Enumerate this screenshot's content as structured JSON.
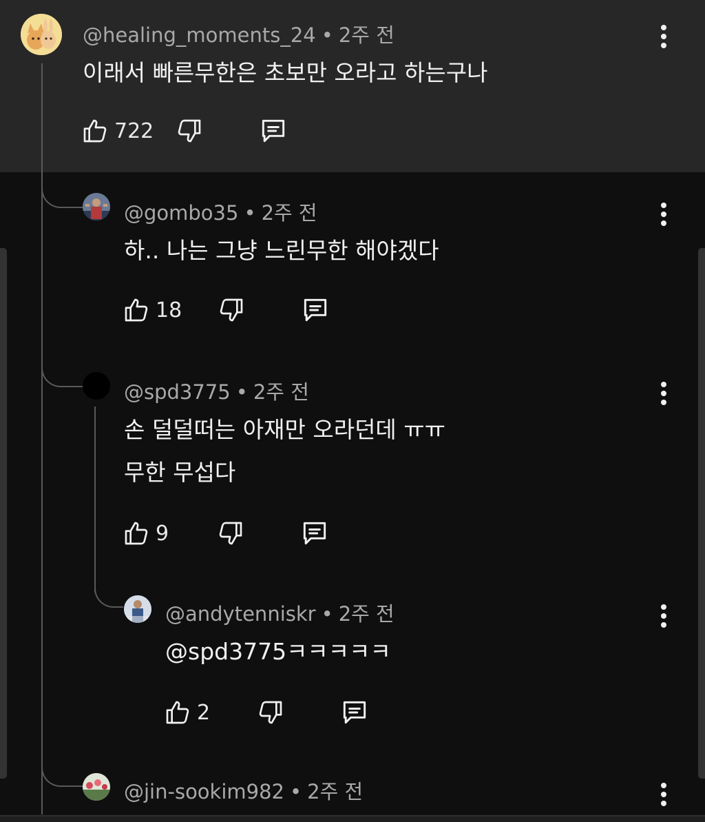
{
  "comments": [
    {
      "handle": "@healing_moments_24",
      "time": "2주 전",
      "lines": [
        "이래서 빠른무한은 초보만 오라고 하는구나"
      ],
      "likes": "722",
      "avatar_icon": "cat-dog-cartoon-avatar",
      "accent": "#f5d58a"
    },
    {
      "handle": "@gombo35",
      "time": "2주 전",
      "lines": [
        "하.. 나는 그냥 느린무한 해야겠다"
      ],
      "likes": "18",
      "avatar_icon": "person-photo-avatar",
      "accent": "#b33a3a"
    },
    {
      "handle": "@spd3775",
      "time": "2주 전",
      "lines": [
        "손 덜덜떠는 아재만 오라던데 ㅠㅠ",
        "무한 무섭다"
      ],
      "likes": "9",
      "avatar_icon": "black-circle-avatar",
      "accent": "#000000"
    },
    {
      "handle": "@andytenniskr",
      "time": "2주 전",
      "lines": [
        "@spd3775ㅋㅋㅋㅋㅋ"
      ],
      "likes": "2",
      "avatar_icon": "person-tennis-avatar",
      "accent": "#8aa4c8"
    },
    {
      "handle": "@jin-sookim982",
      "time": "2주 전",
      "lines": [],
      "likes": "",
      "avatar_icon": "flowers-avatar",
      "accent": "#6a8a5a"
    }
  ],
  "ui": {
    "separator": "•",
    "like_icon": "thumbs-up-icon",
    "dislike_icon": "thumbs-down-icon",
    "reply_icon": "reply-icon",
    "more_icon": "more-vert-icon"
  }
}
